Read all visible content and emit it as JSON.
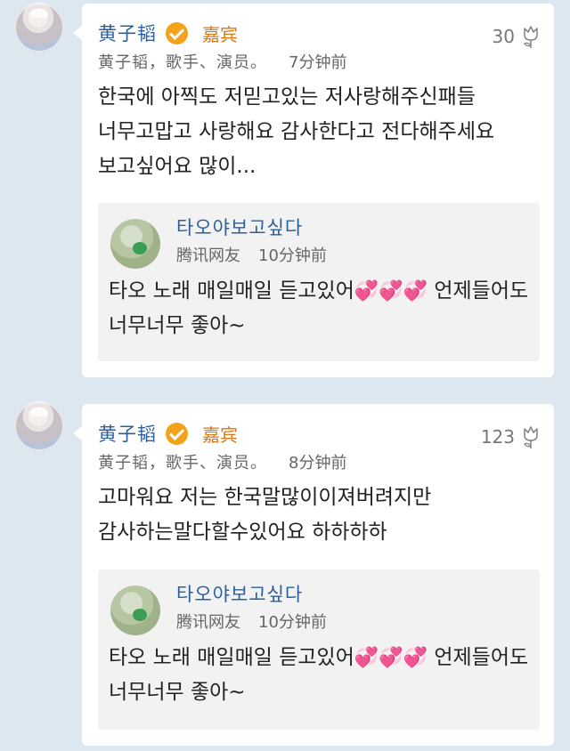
{
  "comments": [
    {
      "author": "黄子韬",
      "badge": "嘉宾",
      "description": "黄子韬，歌手、演员。",
      "time": "7分钟前",
      "likes": "30",
      "text": "한국에 아찍도 저믿고있는 저사랑해주신패들 너무고맙고 사랑해요 감사한다고 전다해주세요 보고싶어요 많이...",
      "quote": {
        "author": "타오야보고싶다",
        "source": "腾讯网友",
        "time": "10分钟前",
        "text_a": "타오 노래 매일매일 듣고있어",
        "emoji": "💞💞💞",
        "text_b": " 언제들어도 너무너무 좋아~"
      }
    },
    {
      "author": "黄子韬",
      "badge": "嘉宾",
      "description": "黄子韬，歌手、演员。",
      "time": "8分钟前",
      "likes": "123",
      "text": "고마워요 저는 한국말많이이져버려지만 감사하는말다할수있어요 하하하하",
      "quote": {
        "author": "타오야보고싶다",
        "source": "腾讯网友",
        "time": "10分钟前",
        "text_a": "타오 노래 매일매일 듣고있어",
        "emoji": "💞💞💞",
        "text_b": " 언제들어도 너무너무 좋아~"
      }
    }
  ],
  "colors": {
    "name": "#2d5f9b",
    "badge": "#d77a1c",
    "verify": "#f2a31a",
    "background": "#dce7f0"
  },
  "icons": {
    "verify": "verified-check-icon",
    "like": "flower-like-icon"
  }
}
